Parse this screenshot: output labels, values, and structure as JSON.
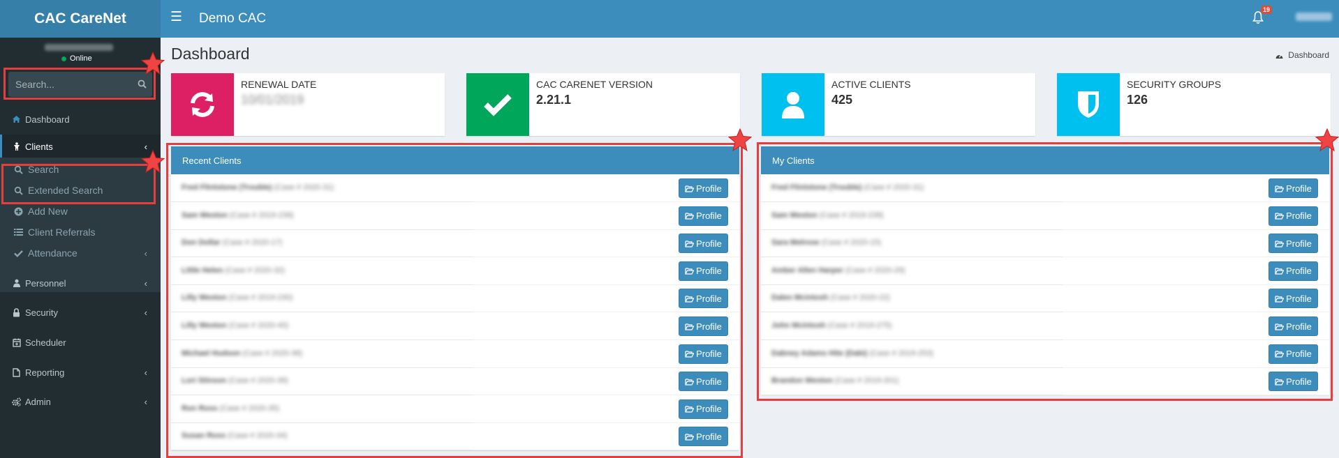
{
  "app": {
    "logo": "CAC CareNet",
    "title": "Demo CAC",
    "notification_count": "19",
    "colors": {
      "header": "#3c8dbc",
      "logo_bg": "#367fa9",
      "sidebar": "#222d32",
      "highlight": "#e53e3e"
    }
  },
  "sidebar": {
    "user_status": "Online",
    "search_placeholder": "Search...",
    "items": [
      {
        "label": "Dashboard",
        "icon": "home-icon"
      },
      {
        "label": "Clients",
        "icon": "child-icon"
      },
      {
        "label": "Personnel",
        "icon": "user-icon"
      },
      {
        "label": "Security",
        "icon": "lock-icon"
      },
      {
        "label": "Scheduler",
        "icon": "calendar-icon"
      },
      {
        "label": "Reporting",
        "icon": "file-icon"
      },
      {
        "label": "Admin",
        "icon": "cogs-icon"
      }
    ],
    "clients_submenu": [
      {
        "label": "Search",
        "icon": "search-icon"
      },
      {
        "label": "Extended Search",
        "icon": "search-icon"
      },
      {
        "label": "Add New",
        "icon": "plus-circle-icon"
      },
      {
        "label": "Client Referrals",
        "icon": "list-icon"
      },
      {
        "label": "Attendance",
        "icon": "check-icon"
      }
    ]
  },
  "page": {
    "title": "Dashboard",
    "breadcrumb": "Dashboard"
  },
  "info_boxes": [
    {
      "label": "RENEWAL DATE",
      "value": "10/01/2019",
      "color": "#dd1f63",
      "icon": "refresh-icon"
    },
    {
      "label": "CAC CARENET VERSION",
      "value": "2.21.1",
      "color": "#00a65a",
      "icon": "check-icon"
    },
    {
      "label": "ACTIVE CLIENTS",
      "value": "425",
      "color": "#00c0ef",
      "icon": "user-icon"
    },
    {
      "label": "SECURITY GROUPS",
      "value": "126",
      "color": "#00c0ef",
      "icon": "shield-icon"
    }
  ],
  "recent_clients": {
    "title": "Recent Clients",
    "button_label": "Profile",
    "rows": [
      {
        "name": "Fred Flintstone (Trouble)",
        "case": "(Case # 2020-31)"
      },
      {
        "name": "Sam Weston",
        "case": "(Case # 2019-239)"
      },
      {
        "name": "Don Dollar",
        "case": "(Case # 2020-17)"
      },
      {
        "name": "Little Helen",
        "case": "(Case # 2020-32)"
      },
      {
        "name": "Lilly Weston",
        "case": "(Case # 2019-230)"
      },
      {
        "name": "Lilly Weston",
        "case": "(Case # 2020-40)"
      },
      {
        "name": "Michael Hudson",
        "case": "(Case # 2020-38)"
      },
      {
        "name": "Lori Stinson",
        "case": "(Case # 2020-39)"
      },
      {
        "name": "Ron Ross",
        "case": "(Case # 2020-35)"
      },
      {
        "name": "Susan Ross",
        "case": "(Case # 2020-34)"
      }
    ]
  },
  "my_clients": {
    "title": "My Clients",
    "button_label": "Profile",
    "rows": [
      {
        "name": "Fred Flintstone (Trouble)",
        "case": "(Case # 2020-31)"
      },
      {
        "name": "Sam Weston",
        "case": "(Case # 2019-239)"
      },
      {
        "name": "Sara Melrose",
        "case": "(Case # 2020-15)"
      },
      {
        "name": "Amber Allen Harper",
        "case": "(Case # 2020-29)"
      },
      {
        "name": "Dalen Mcintosh",
        "case": "(Case # 2020-22)"
      },
      {
        "name": "John Mcintosh",
        "case": "(Case # 2019-275)"
      },
      {
        "name": "Dabney Adams Hite (Dabi)",
        "case": "(Case # 2019-253)"
      },
      {
        "name": "Brandon Weston",
        "case": "(Case # 2019-201)"
      }
    ]
  }
}
